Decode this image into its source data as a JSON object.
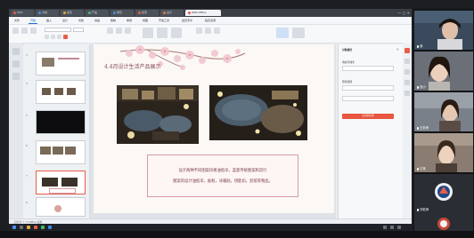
{
  "browser": {
    "tabs": [
      {
        "label": "WPS"
      },
      {
        "label": "文档"
      },
      {
        "label": "首页"
      },
      {
        "label": "产品"
      },
      {
        "label": "网页"
      },
      {
        "label": "搜索"
      },
      {
        "label": "演示"
      },
      {
        "label": "WPS Office"
      }
    ]
  },
  "menu": {
    "items": [
      "文件",
      "开始",
      "插入",
      "设计",
      "切换",
      "动画",
      "放映",
      "审阅",
      "视图",
      "开发工具",
      "会员专享",
      "稻壳资源"
    ]
  },
  "slide": {
    "title": "4.4月设计生活产品展示",
    "caption_lines": [
      "设计两种不同图案风格油纸伞，蓝意传统图案和流行",
      "图案的设计油纸伞，画框，冰箱贴，钥匙扣，剪纸等物品。"
    ]
  },
  "thumbnails": {
    "numbers": [
      "3",
      "4",
      "5",
      "6",
      "7",
      "8"
    ]
  },
  "task_pane": {
    "title": "对象属性",
    "field1": "填充与线条",
    "field2": "形状选项",
    "apply": "应用到全部"
  },
  "statusbar": {
    "text": "幻灯片 7 / 9    Office 主题"
  },
  "participants": [
    {
      "name": "我",
      "bg": "#3a4a5c"
    },
    {
      "name": "钱小",
      "bg": "#6b6f78"
    },
    {
      "name": "王老师",
      "bg": "#7a8089"
    },
    {
      "name": "王某",
      "bg": "#8a7c70"
    },
    {
      "name": "刘老师",
      "bg": "#2a2e34"
    },
    {
      "name": "",
      "bg": "#2a2e34"
    }
  ],
  "colors": {
    "accent": "#1c6fd6",
    "wps_red": "#e85d4a",
    "caption": "#7a3a4a"
  }
}
